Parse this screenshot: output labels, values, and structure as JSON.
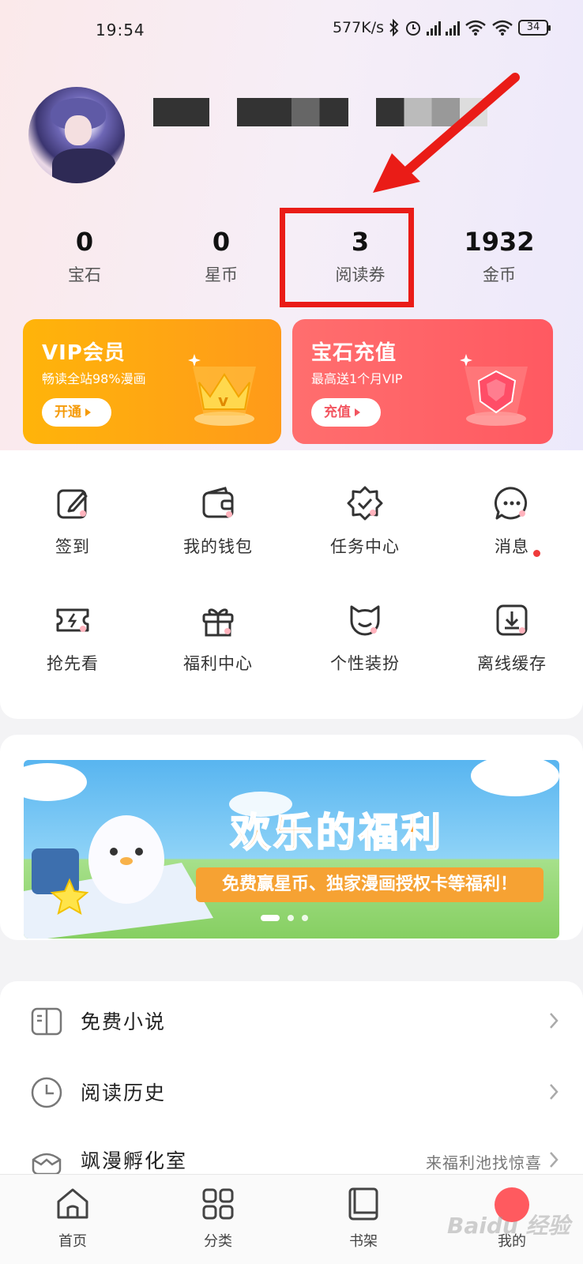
{
  "status_bar": {
    "time": "19:54",
    "speed": "577K/s",
    "battery": "34"
  },
  "profile": {
    "avatar": "avatar"
  },
  "stats": [
    {
      "value": "0",
      "label": "宝石"
    },
    {
      "value": "0",
      "label": "星币"
    },
    {
      "value": "3",
      "label": "阅读券"
    },
    {
      "value": "1932",
      "label": "金币"
    }
  ],
  "annotation": {
    "highlight_color": "#ea1c17"
  },
  "promos": {
    "vip": {
      "title": "VIP会员",
      "subtitle": "畅读全站98%漫画",
      "button": "开通"
    },
    "gem": {
      "title": "宝石充值",
      "subtitle": "最高送1个月VIP",
      "button": "充值"
    }
  },
  "grid": [
    {
      "label": "签到",
      "icon": "edit-icon"
    },
    {
      "label": "我的钱包",
      "icon": "wallet-icon"
    },
    {
      "label": "任务中心",
      "icon": "badge-check-icon"
    },
    {
      "label": "消息",
      "icon": "chat-bubble-icon"
    },
    {
      "label": "抢先看",
      "icon": "ticket-icon"
    },
    {
      "label": "福利中心",
      "icon": "gift-icon"
    },
    {
      "label": "个性装扮",
      "icon": "cat-face-icon"
    },
    {
      "label": "离线缓存",
      "icon": "download-icon"
    }
  ],
  "banner": {
    "title": "欢乐的福利",
    "subtitle": "免费赢星币、独家漫画授权卡等福利！"
  },
  "menu": [
    {
      "label": "免费小说",
      "hint": "",
      "icon": "book-open-icon"
    },
    {
      "label": "阅读历史",
      "hint": "",
      "icon": "clock-icon"
    },
    {
      "label": "飒漫孵化室",
      "hint": "来福利池找惊喜",
      "icon": "egg-icon"
    }
  ],
  "tabbar": [
    {
      "label": "首页",
      "icon": "home-icon"
    },
    {
      "label": "分类",
      "icon": "grid-icon"
    },
    {
      "label": "书架",
      "icon": "bookshelf-icon"
    },
    {
      "label": "我的",
      "icon": "profile-icon"
    }
  ],
  "watermark": "Baidu 经验",
  "colors": {
    "vip": "#ffa60f",
    "gem": "#ff6166",
    "accent_red": "#ef3b3b"
  }
}
